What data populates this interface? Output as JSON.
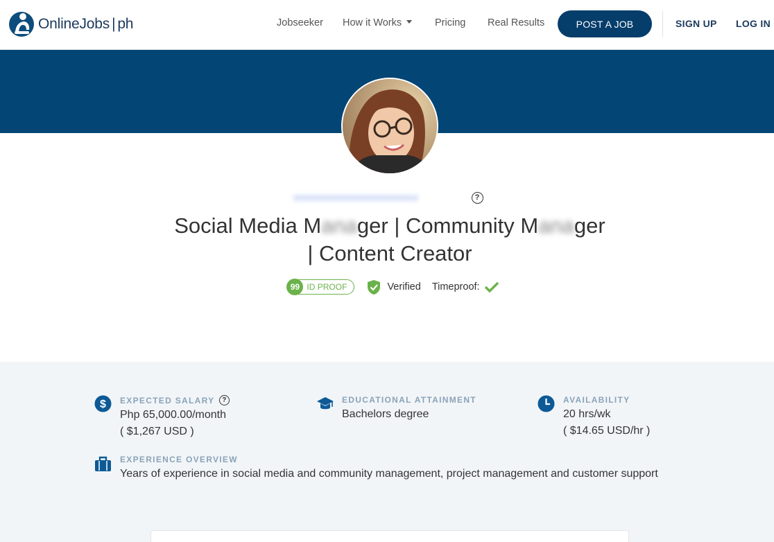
{
  "brand": {
    "name": "OnlineJobs",
    "suffix": "ph"
  },
  "nav": {
    "items": [
      {
        "label": "Jobseeker"
      },
      {
        "label": "How it Works"
      },
      {
        "label": "Pricing"
      },
      {
        "label": "Real Results"
      }
    ],
    "post_job": "POST A JOB",
    "sign_up": "SIGN UP",
    "log_in": "LOG IN"
  },
  "profile": {
    "name_blurred": "xxxxxxxxxxxxxxxxxxxxxxxx",
    "title_part1": "Social Media M",
    "title_blur1": "ana",
    "title_part2": "ger | Community M",
    "title_blur2": "ana",
    "title_part3": "ger",
    "title_line2": "| Content Creator",
    "id_proof_score": "99",
    "id_proof_label": "ID PROOF",
    "verified_label": "Verified",
    "timeproof_label": "Timeproof:"
  },
  "info": {
    "salary": {
      "label": "EXPECTED SALARY",
      "value": "Php 65,000.00/month",
      "usd": "( $1,267 USD )"
    },
    "education": {
      "label": "EDUCATIONAL ATTAINMENT",
      "value": "Bachelors degree"
    },
    "availability": {
      "label": "AVAILABILITY",
      "value": "20 hrs/wk",
      "rate": "( $14.65 USD/hr )"
    },
    "experience": {
      "label": "EXPERIENCE OVERVIEW",
      "value": "Years of experience in social media and community management, project management and customer support"
    }
  },
  "colors": {
    "brand_navy": "#034575",
    "button_navy": "#053d6b",
    "green": "#6ab24a",
    "icon_blue": "#0d5a96"
  }
}
